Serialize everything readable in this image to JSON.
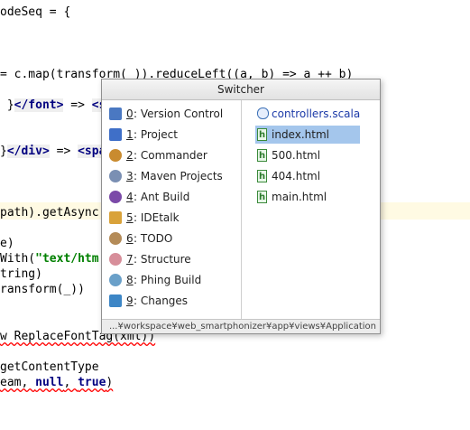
{
  "editor": {
    "lines": [
      {
        "text": "odeSeq = {"
      },
      {
        "text": "= c.map(transform(_)).reduceLeft((a, b) => a ++ b)"
      },
      {
        "text_a": " }",
        "tag": "</font>",
        "text_b": " => ",
        "tag2": "<s"
      },
      {
        "text_a": "}",
        "tag": "</div>",
        "text_b": " => ",
        "tag2": "<spa"
      },
      {
        "text": "path).getAsync"
      },
      {
        "text": "e)"
      },
      {
        "text_a": "With(",
        "str": "\"text/htm",
        "text_b": ""
      },
      {
        "text": "tring)"
      },
      {
        "text": "ransform(_))"
      },
      {
        "text": "w ReplaceFontTag(xml))"
      },
      {
        "text": "getContentType"
      },
      {
        "text_a": "eam, ",
        "kw1": "null",
        "text_b": ", ",
        "kw2": "true",
        "text_c": ")"
      }
    ]
  },
  "switcher": {
    "title": "Switcher",
    "tool_windows": [
      {
        "number": "0",
        "label": ": Version Control",
        "icon": "version-control-icon",
        "color": "#4a78c2"
      },
      {
        "number": "1",
        "label": ": Project",
        "icon": "project-icon",
        "color": "#3f6fc8"
      },
      {
        "number": "2",
        "label": ": Commander",
        "icon": "commander-icon",
        "color": "#c98b2f"
      },
      {
        "number": "3",
        "label": ": Maven Projects",
        "icon": "maven-icon",
        "color": "#7a8fb3"
      },
      {
        "number": "4",
        "label": ": Ant Build",
        "icon": "ant-icon",
        "color": "#7b4aa8"
      },
      {
        "number": "5",
        "label": ": IDEtalk",
        "icon": "idetalk-icon",
        "color": "#d9a23a"
      },
      {
        "number": "6",
        "label": ": TODO",
        "icon": "todo-icon",
        "color": "#b48b58"
      },
      {
        "number": "7",
        "label": ": Structure",
        "icon": "structure-icon",
        "color": "#d78e9a"
      },
      {
        "number": "8",
        "label": ": Phing Build",
        "icon": "phing-icon",
        "color": "#6aa0c9"
      },
      {
        "number": "9",
        "label": ": Changes",
        "icon": "changes-icon",
        "color": "#3d86c6"
      }
    ],
    "files": [
      {
        "label": "controllers.scala",
        "icon": "scala-file-icon",
        "blue": true,
        "selected": false
      },
      {
        "label": "index.html",
        "icon": "html-file-icon",
        "blue": false,
        "selected": true
      },
      {
        "label": "500.html",
        "icon": "html-file-icon",
        "blue": false,
        "selected": false
      },
      {
        "label": "404.html",
        "icon": "html-file-icon",
        "blue": false,
        "selected": false
      },
      {
        "label": "main.html",
        "icon": "html-file-icon",
        "blue": false,
        "selected": false
      }
    ],
    "path": "...¥workspace¥web_smartphonizer¥app¥views¥Application"
  }
}
